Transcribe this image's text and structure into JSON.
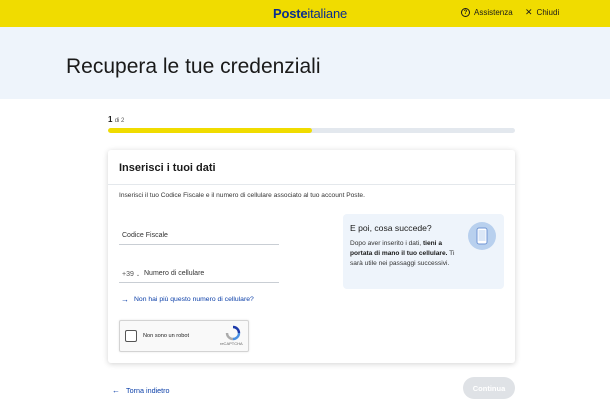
{
  "header": {
    "logo_bold": "Poste",
    "logo_light": "italiane",
    "help_label": "Assistenza",
    "close_label": "Chiudi"
  },
  "page": {
    "title": "Recupera le tue credenziali"
  },
  "stepper": {
    "current": "1",
    "of_label": "di 2",
    "progress": 0.5
  },
  "form": {
    "title": "Inserisci i tuoi dati",
    "description": "Inserisci il tuo Codice Fiscale e il numero di cellulare associato al tuo account Poste.",
    "fiscal_code_label": "Codice Fiscale",
    "phone_prefix": "+39",
    "phone_label": "Numero di cellulare",
    "lost_number_link": "Non hai più questo numero di cellulare?",
    "captcha_label": "Non sono un robot",
    "captcha_brand": "reCAPTCHA"
  },
  "info": {
    "title": "E poi, cosa succede?",
    "text_1": "Dopo aver inserito i dati, ",
    "text_bold": "tieni a portata di mano il tuo cellulare.",
    "text_2": " Ti sarà utile nei passaggi successivi."
  },
  "footer": {
    "back_label": "Torna indietro",
    "continue_label": "Continua"
  },
  "colors": {
    "brand_yellow": "#f0dc00",
    "brand_blue": "#0a2d8f",
    "link_blue": "#0a3ea8",
    "hero_bg": "#eef4fb"
  },
  "icons": [
    "question-circle-icon",
    "close-icon",
    "arrow-right-icon",
    "arrow-left-icon",
    "phone-icon",
    "recaptcha-icon",
    "chevron-down-icon"
  ]
}
